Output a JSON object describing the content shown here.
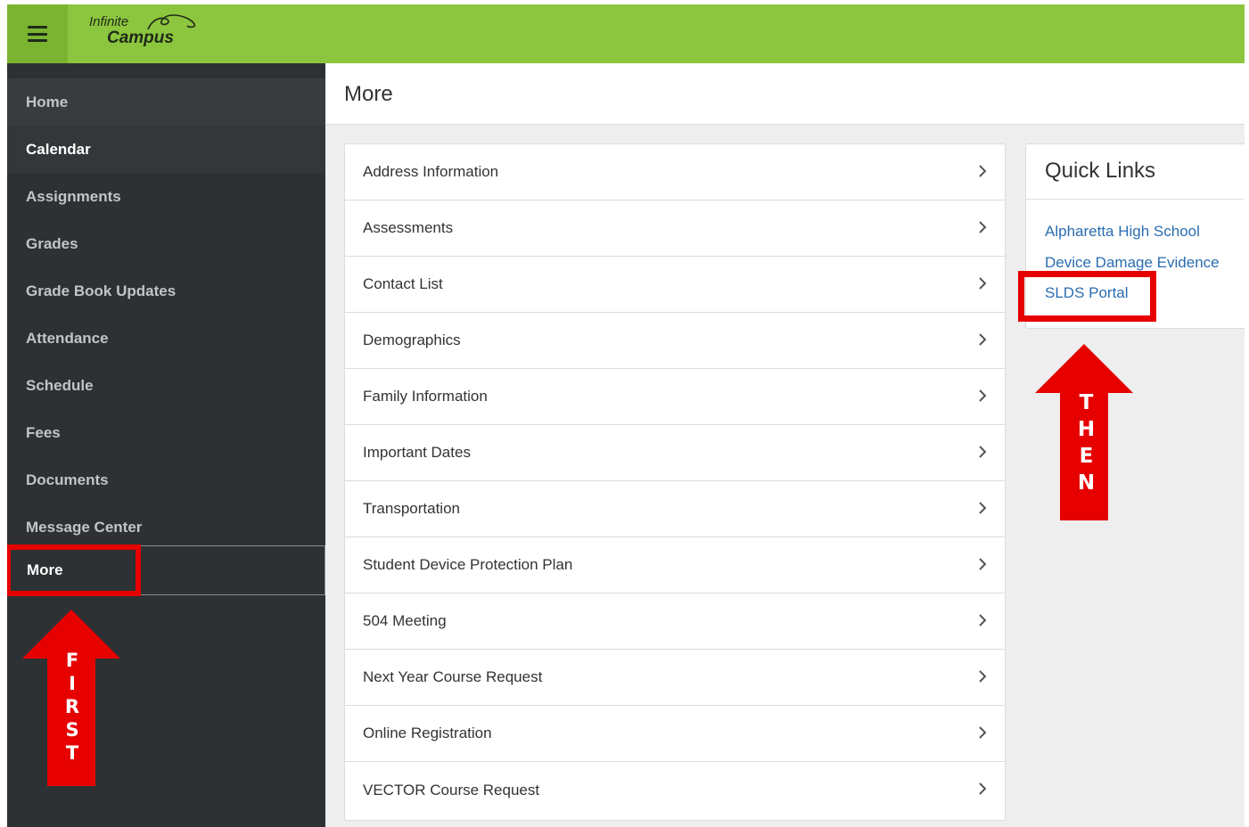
{
  "header": {
    "logo_line1": "Infinite",
    "logo_line2": "Campus",
    "menu_icon": "hamburger-icon",
    "colors": {
      "bar": "#8cc63e",
      "menu_button": "#7ab431"
    }
  },
  "sidebar": {
    "items": [
      {
        "label": "Home"
      },
      {
        "label": "Calendar"
      },
      {
        "label": "Assignments"
      },
      {
        "label": "Grades"
      },
      {
        "label": "Grade Book Updates"
      },
      {
        "label": "Attendance"
      },
      {
        "label": "Schedule"
      },
      {
        "label": "Fees"
      },
      {
        "label": "Documents"
      },
      {
        "label": "Message Center"
      },
      {
        "label": "More"
      }
    ],
    "selected": "More",
    "colors": {
      "background": "#2d3133"
    }
  },
  "main": {
    "title": "More",
    "list": [
      {
        "label": "Address Information"
      },
      {
        "label": "Assessments"
      },
      {
        "label": "Contact List"
      },
      {
        "label": "Demographics"
      },
      {
        "label": "Family Information"
      },
      {
        "label": "Important Dates"
      },
      {
        "label": "Transportation"
      },
      {
        "label": "Student Device Protection Plan"
      },
      {
        "label": "504 Meeting"
      },
      {
        "label": "Next Year Course Request"
      },
      {
        "label": "Online Registration"
      },
      {
        "label": "VECTOR Course Request"
      }
    ],
    "list_icon": "chevron-right-icon"
  },
  "quick_links": {
    "title": "Quick Links",
    "links": [
      {
        "label": "Alpharetta High School"
      },
      {
        "label": "Device Damage Evidence"
      },
      {
        "label": "SLDS Portal"
      }
    ],
    "colors": {
      "link": "#2a6db0"
    }
  },
  "annotations": {
    "first_arrow": "FIRST",
    "then_arrow": "THEN",
    "color": "#e60000"
  }
}
